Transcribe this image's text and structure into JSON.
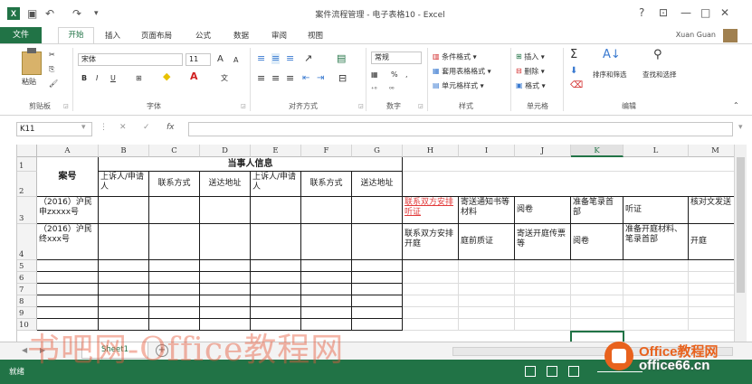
{
  "window": {
    "title": "案件流程管理 - 电子表格10 - Excel",
    "help": "?",
    "controls": [
      "⊡",
      "—",
      "□",
      "✕"
    ]
  },
  "user": {
    "name": "Xuan Guan"
  },
  "ribbon_tabs": [
    "文件",
    "开始",
    "插入",
    "页面布局",
    "公式",
    "数据",
    "审阅",
    "视图"
  ],
  "active_tab": "开始",
  "ribbon": {
    "clipboard": {
      "paste": "粘贴",
      "label": "剪贴板"
    },
    "font": {
      "name": "宋体",
      "size": "11",
      "grow": "A",
      "shrink": "A",
      "bold": "B",
      "italic": "I",
      "underline": "U",
      "label": "字体"
    },
    "alignment": {
      "label": "对齐方式"
    },
    "number": {
      "format": "常规",
      "percent": "%",
      "comma": ",",
      "label": "数字"
    },
    "styles": {
      "conditional": "条件格式",
      "table": "套用表格格式",
      "cell": "单元格样式",
      "label": "样式"
    },
    "cells": {
      "insert": "插入",
      "delete": "删除",
      "format": "格式",
      "label": "单元格"
    },
    "editing": {
      "sum": "Σ",
      "sort": "排序和筛选",
      "find": "查找和选择",
      "label": "编辑"
    }
  },
  "formula_bar": {
    "name_box": "K11",
    "cancel": "✕",
    "enter": "✓",
    "fx": "fx",
    "value": ""
  },
  "columns": [
    "A",
    "B",
    "C",
    "D",
    "E",
    "F",
    "G",
    "H",
    "I",
    "J",
    "K",
    "L",
    "M"
  ],
  "selected_column": "K",
  "rows": [
    "1",
    "2",
    "3",
    "4",
    "5",
    "6",
    "7",
    "8",
    "9",
    "10"
  ],
  "table": {
    "case_no_header": "案号",
    "party_header": "当事人信息",
    "sub_headers": [
      "上诉人/申请人",
      "联系方式",
      "送达地址",
      "上诉人/申请人",
      "联系方式",
      "送达地址"
    ],
    "row3": {
      "a": "（2016）沪民申zxxxx号",
      "h": "联系双方安排听证",
      "i": "寄送通知书等材料",
      "j": "阅卷",
      "k": "准备笔录首部",
      "l": "听证",
      "m": "核对文发送"
    },
    "row4": {
      "a": "（2016）沪民终xxx号",
      "h": "联系双方安排开庭",
      "i": "庭前质证",
      "j": "寄送开庭传票等",
      "k": "阅卷",
      "l": "准备开庭材料、笔录首部",
      "m": "开庭"
    }
  },
  "sheet_tabs": [
    "Sheet1"
  ],
  "add_sheet": "+",
  "status": {
    "text": "就绪"
  },
  "watermark": {
    "left": "书吧网-Office教程网",
    "right_top": "Office教程网",
    "right_bottom": "office66.cn"
  }
}
